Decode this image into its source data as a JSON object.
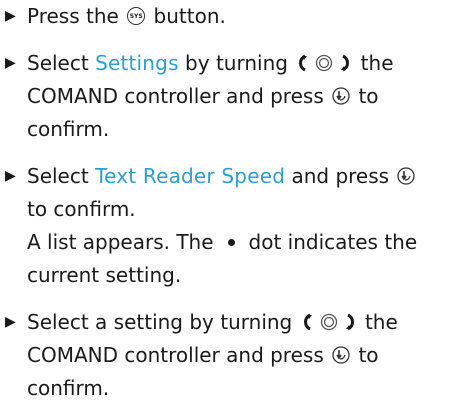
{
  "steps": [
    {
      "before": "Press the ",
      "icon_sys_label": "SYS",
      "after": " button."
    },
    {
      "before": "Select ",
      "menu": "Settings",
      "middle": " by turning ",
      "middle2": " the COMAND controller and press ",
      "after": " to confirm."
    },
    {
      "before": "Select ",
      "menu": "Text Reader Speed",
      "middle": " and press ",
      "after": " to confirm.",
      "note_before": "A list appears. The",
      "note_after": "dot indicates the current setting."
    },
    {
      "before": "Select a setting by turning ",
      "middle": " the COMAND controller and press ",
      "after": " to confirm."
    }
  ],
  "colors": {
    "menu_text": "#2a9fd6",
    "body_text": "#1a1a1a"
  },
  "icons": {
    "bullet": "triangle-bullet-icon",
    "system_button": "system-button-icon",
    "controller_turn": "controller-turn-icon",
    "controller_press": "controller-press-icon",
    "selection_dot": "selection-dot-icon"
  }
}
